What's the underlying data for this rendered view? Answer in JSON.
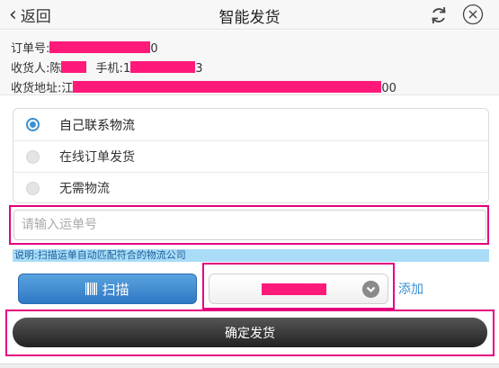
{
  "header": {
    "back_label": "返回",
    "title": "智能发货",
    "refresh_icon": "refresh-icon",
    "close_icon": "close-icon"
  },
  "order": {
    "order_no_label": "订单号:",
    "order_no_prefix": "",
    "order_no_suffix": "0",
    "receiver_label": "收货人:",
    "receiver_prefix": "陈",
    "phone_label": "手机:",
    "phone_prefix": "1",
    "phone_suffix": "3",
    "address_label": "收货地址:",
    "address_prefix": "江",
    "address_suffix": "00"
  },
  "shipping_methods": [
    {
      "label": "自己联系物流",
      "selected": true
    },
    {
      "label": "在线订单发货",
      "selected": false
    },
    {
      "label": "无需物流",
      "selected": false
    }
  ],
  "tracking": {
    "placeholder": "请输入运单号",
    "value": ""
  },
  "hint": "说明:扫描运单自动匹配符合的物流公司",
  "scan_label": "扫描",
  "carrier": {
    "selected": "",
    "add_label": "添加"
  },
  "confirm_label": "确定发货",
  "colors": {
    "accent_blue": "#3a8fd0",
    "highlight": "#e5007e",
    "mask": "#ff1a7a",
    "hint_bg": "#a9dcf7"
  }
}
